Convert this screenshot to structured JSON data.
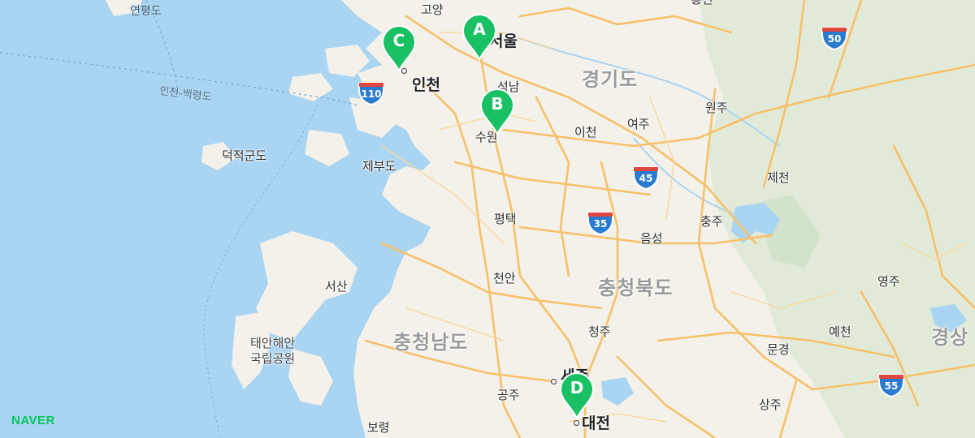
{
  "map": {
    "provider_logo": "NAVER",
    "colors": {
      "sea": "#a9d4f2",
      "land": "#f3f1ea",
      "road": "#f7c06a",
      "highway_shield": "#2a7bd1",
      "marker": "#19c164",
      "forest": "#dbe7d3"
    },
    "markers": [
      {
        "label": "A",
        "name": "marker-a"
      },
      {
        "label": "B",
        "name": "marker-b"
      },
      {
        "label": "C",
        "name": "marker-c"
      },
      {
        "label": "D",
        "name": "marker-d"
      }
    ],
    "highway_shields": [
      "50",
      "110",
      "45",
      "35",
      "55"
    ],
    "places": {
      "yeonpyeongdo": "연평도",
      "goyang": "고양",
      "seoul": "서울",
      "incheon": "인천",
      "seongnam": "성남",
      "gyeonggido": "경기도",
      "wonju": "원주",
      "suwon": "수원",
      "icheon": "이천",
      "yeoju": "여주",
      "jecheon": "제천",
      "deokjeokgundo": "덕적군도",
      "jebudo": "제부도",
      "pyeongtaek": "평택",
      "chungju": "충주",
      "eumseong": "음성",
      "seosan": "서산",
      "cheonan": "천안",
      "chungcheongbukdo": "충청북도",
      "yeongju": "영주",
      "taean_park": "태안해안\n국립공원",
      "chungcheongnamdo": "충청남도",
      "cheongju": "청주",
      "yecheon": "예천",
      "gyeongsang": "경상",
      "mungyeong": "문경",
      "sejong": "세종",
      "gongju": "공주",
      "daejeon": "대전",
      "sangju": "상주",
      "boryeong": "보령",
      "hongcheon": "홍천"
    },
    "ferry_route": "인천-백령도"
  }
}
